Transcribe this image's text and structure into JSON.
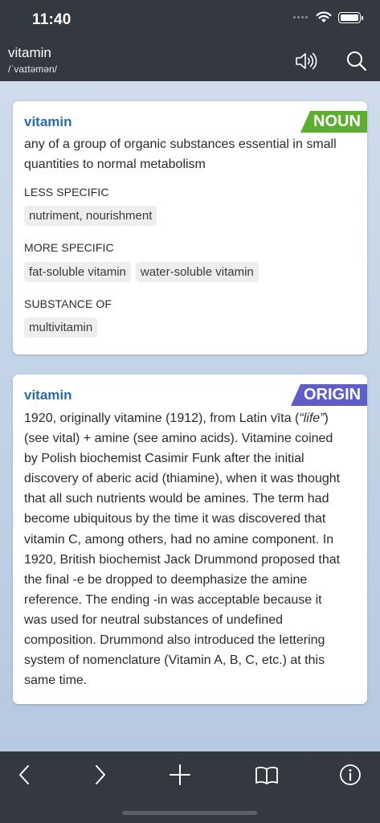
{
  "status": {
    "time": "11:40"
  },
  "header": {
    "word": "vitamin",
    "phonetic": "/ˈvaɪtəmən/",
    "speaker_icon": "speaker-icon",
    "search_icon": "search-icon"
  },
  "noun_card": {
    "word": "vitamin",
    "tag": "NOUN",
    "tag_color": "#5dae2f",
    "definition": "any of a group of organic substances essential in small quantities to normal metabolism",
    "sections": [
      {
        "heading": "LESS SPECIFIC",
        "chips": [
          "nutriment, nourishment"
        ]
      },
      {
        "heading": "MORE SPECIFIC",
        "chips": [
          "fat-soluble vitamin",
          "water-soluble vitamin"
        ]
      },
      {
        "heading": "SUBSTANCE OF",
        "chips": [
          "multivitamin"
        ]
      }
    ]
  },
  "origin_card": {
    "word": "vitamin",
    "tag": "ORIGIN",
    "tag_color": "#5f5ec8",
    "text_before": "1920, originally vitamine (1912), from Latin vīta (",
    "text_italic": "“life”",
    "text_after": ") (see vital) + amine (see amino acids). Vitamine coined by Polish biochemist Casimir Funk after the initial discovery of aberic acid (thiamine), when it was thought that all such nutrients would be amines. The term had become ubiquitous by the time it was discovered that vitamin C, among others, had no amine component. In 1920, British biochemist Jack Drummond proposed that the final -e be dropped to deemphasize the amine reference. The ending -in was acceptable because it was used for neutral substances of undefined composition. Drummond also introduced the lettering system of nomenclature (Vitamin A, B, C, etc.) at this same time."
  },
  "toolbar": {
    "icons": [
      "back-icon",
      "forward-icon",
      "add-icon",
      "book-icon",
      "info-icon"
    ]
  },
  "colors": {
    "bar": "#34393f",
    "link_blue": "#2d6aa8"
  }
}
